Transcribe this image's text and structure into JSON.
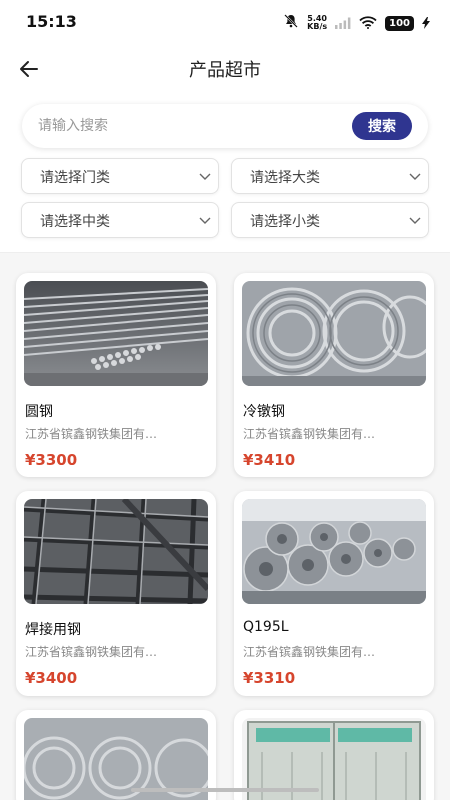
{
  "status_bar": {
    "time": "15:13",
    "net_speed_value": "5.40",
    "net_speed_unit": "KB/s",
    "battery": "100"
  },
  "header": {
    "title": "产品超市"
  },
  "search": {
    "placeholder": "请输入搜索",
    "button_label": "搜索"
  },
  "filters": {
    "door_category": "请选择门类",
    "major_category": "请选择大类",
    "middle_category": "请选择中类",
    "minor_category": "请选择小类"
  },
  "products": [
    {
      "name": "圆钢",
      "company": "江苏省镔鑫钢铁集团有…",
      "price": "¥3300"
    },
    {
      "name": "冷镦钢",
      "company": "江苏省镔鑫钢铁集团有…",
      "price": "¥3410"
    },
    {
      "name": "焊接用钢",
      "company": "江苏省镔鑫钢铁集团有…",
      "price": "¥3400"
    },
    {
      "name": "Q195L",
      "company": "江苏省镔鑫钢铁集团有…",
      "price": "¥3310"
    }
  ],
  "colors": {
    "accent": "#2f3590",
    "price": "#d6452d"
  }
}
